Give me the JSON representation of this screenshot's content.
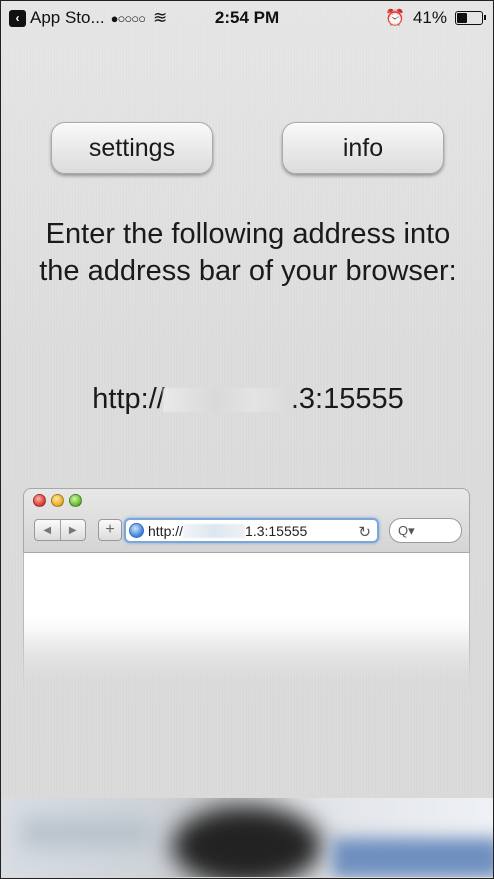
{
  "status_bar": {
    "back_app": "App Sto...",
    "signal": "●○○○○",
    "wifi": "≋",
    "time": "2:54 PM",
    "alarm": "⏰",
    "battery_percent": "41%",
    "battery_level": 0.41
  },
  "buttons": {
    "settings_label": "settings",
    "info_label": "info"
  },
  "instructions": "Enter the following address into the address bar of your browser:",
  "address": {
    "prefix": "http://",
    "suffix": ".3:15555"
  },
  "browser_illustration": {
    "url_prefix": "http://",
    "url_suffix": "1.3:15555",
    "nav_back_icon": "◀",
    "nav_forward_icon": "▶",
    "plus_icon": "+",
    "reload_icon": "↻",
    "search_icon": "Q▾"
  },
  "colors": {
    "background": "#dcdcdc",
    "url_focus_ring": "#7ba6d8"
  }
}
